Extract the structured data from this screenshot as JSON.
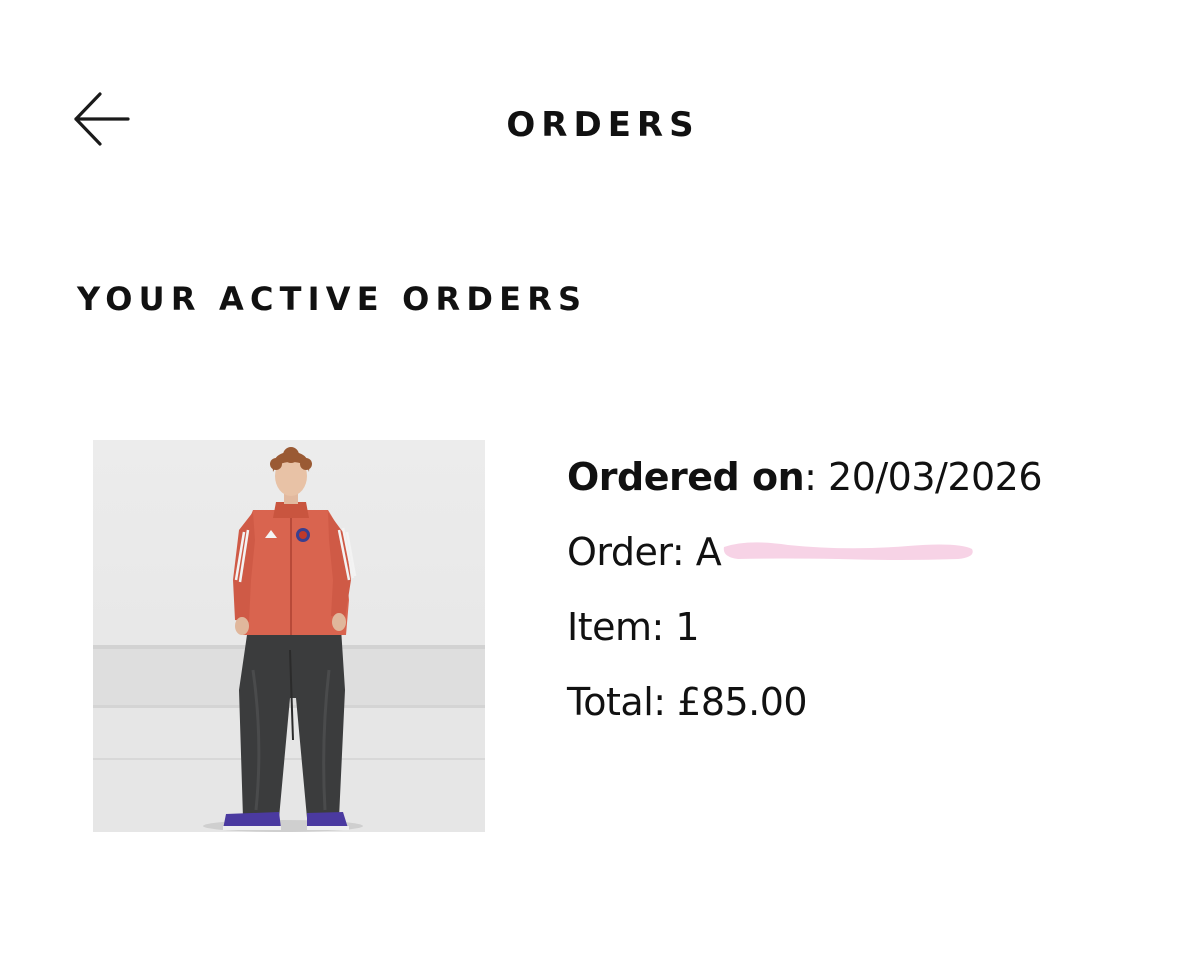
{
  "header": {
    "title": "ORDERS",
    "back_icon": "arrow-left-icon"
  },
  "active_orders": {
    "heading": "YOUR ACTIVE ORDERS",
    "orders": [
      {
        "ordered_on_label": "Ordered on",
        "ordered_on_separator": ": ",
        "ordered_on_value": "20/03/2026",
        "order_label": "Order: ",
        "order_number_visible": "A",
        "order_number_redacted": true,
        "item_label": "Item: ",
        "item_count": "1",
        "total_label": "Total: ",
        "total_value": "£85.00",
        "image_icon": "product-photo-tracksuit-icon"
      }
    ]
  },
  "colors": {
    "text": "#111111",
    "background": "#ffffff",
    "redaction": "#f7d3e6",
    "jacket": "#d9644f",
    "jeans": "#3a3a3a",
    "backdrop": "#e9e9e9"
  }
}
